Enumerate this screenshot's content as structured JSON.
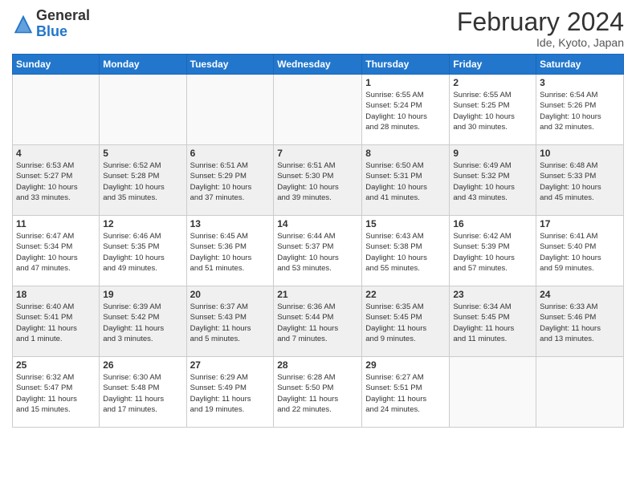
{
  "header": {
    "logo_general": "General",
    "logo_blue": "Blue",
    "month_year": "February 2024",
    "location": "Ide, Kyoto, Japan"
  },
  "days_of_week": [
    "Sunday",
    "Monday",
    "Tuesday",
    "Wednesday",
    "Thursday",
    "Friday",
    "Saturday"
  ],
  "weeks": [
    {
      "shaded": false,
      "days": [
        {
          "num": "",
          "info": ""
        },
        {
          "num": "",
          "info": ""
        },
        {
          "num": "",
          "info": ""
        },
        {
          "num": "",
          "info": ""
        },
        {
          "num": "1",
          "info": "Sunrise: 6:55 AM\nSunset: 5:24 PM\nDaylight: 10 hours\nand 28 minutes."
        },
        {
          "num": "2",
          "info": "Sunrise: 6:55 AM\nSunset: 5:25 PM\nDaylight: 10 hours\nand 30 minutes."
        },
        {
          "num": "3",
          "info": "Sunrise: 6:54 AM\nSunset: 5:26 PM\nDaylight: 10 hours\nand 32 minutes."
        }
      ]
    },
    {
      "shaded": true,
      "days": [
        {
          "num": "4",
          "info": "Sunrise: 6:53 AM\nSunset: 5:27 PM\nDaylight: 10 hours\nand 33 minutes."
        },
        {
          "num": "5",
          "info": "Sunrise: 6:52 AM\nSunset: 5:28 PM\nDaylight: 10 hours\nand 35 minutes."
        },
        {
          "num": "6",
          "info": "Sunrise: 6:51 AM\nSunset: 5:29 PM\nDaylight: 10 hours\nand 37 minutes."
        },
        {
          "num": "7",
          "info": "Sunrise: 6:51 AM\nSunset: 5:30 PM\nDaylight: 10 hours\nand 39 minutes."
        },
        {
          "num": "8",
          "info": "Sunrise: 6:50 AM\nSunset: 5:31 PM\nDaylight: 10 hours\nand 41 minutes."
        },
        {
          "num": "9",
          "info": "Sunrise: 6:49 AM\nSunset: 5:32 PM\nDaylight: 10 hours\nand 43 minutes."
        },
        {
          "num": "10",
          "info": "Sunrise: 6:48 AM\nSunset: 5:33 PM\nDaylight: 10 hours\nand 45 minutes."
        }
      ]
    },
    {
      "shaded": false,
      "days": [
        {
          "num": "11",
          "info": "Sunrise: 6:47 AM\nSunset: 5:34 PM\nDaylight: 10 hours\nand 47 minutes."
        },
        {
          "num": "12",
          "info": "Sunrise: 6:46 AM\nSunset: 5:35 PM\nDaylight: 10 hours\nand 49 minutes."
        },
        {
          "num": "13",
          "info": "Sunrise: 6:45 AM\nSunset: 5:36 PM\nDaylight: 10 hours\nand 51 minutes."
        },
        {
          "num": "14",
          "info": "Sunrise: 6:44 AM\nSunset: 5:37 PM\nDaylight: 10 hours\nand 53 minutes."
        },
        {
          "num": "15",
          "info": "Sunrise: 6:43 AM\nSunset: 5:38 PM\nDaylight: 10 hours\nand 55 minutes."
        },
        {
          "num": "16",
          "info": "Sunrise: 6:42 AM\nSunset: 5:39 PM\nDaylight: 10 hours\nand 57 minutes."
        },
        {
          "num": "17",
          "info": "Sunrise: 6:41 AM\nSunset: 5:40 PM\nDaylight: 10 hours\nand 59 minutes."
        }
      ]
    },
    {
      "shaded": true,
      "days": [
        {
          "num": "18",
          "info": "Sunrise: 6:40 AM\nSunset: 5:41 PM\nDaylight: 11 hours\nand 1 minute."
        },
        {
          "num": "19",
          "info": "Sunrise: 6:39 AM\nSunset: 5:42 PM\nDaylight: 11 hours\nand 3 minutes."
        },
        {
          "num": "20",
          "info": "Sunrise: 6:37 AM\nSunset: 5:43 PM\nDaylight: 11 hours\nand 5 minutes."
        },
        {
          "num": "21",
          "info": "Sunrise: 6:36 AM\nSunset: 5:44 PM\nDaylight: 11 hours\nand 7 minutes."
        },
        {
          "num": "22",
          "info": "Sunrise: 6:35 AM\nSunset: 5:45 PM\nDaylight: 11 hours\nand 9 minutes."
        },
        {
          "num": "23",
          "info": "Sunrise: 6:34 AM\nSunset: 5:45 PM\nDaylight: 11 hours\nand 11 minutes."
        },
        {
          "num": "24",
          "info": "Sunrise: 6:33 AM\nSunset: 5:46 PM\nDaylight: 11 hours\nand 13 minutes."
        }
      ]
    },
    {
      "shaded": false,
      "days": [
        {
          "num": "25",
          "info": "Sunrise: 6:32 AM\nSunset: 5:47 PM\nDaylight: 11 hours\nand 15 minutes."
        },
        {
          "num": "26",
          "info": "Sunrise: 6:30 AM\nSunset: 5:48 PM\nDaylight: 11 hours\nand 17 minutes."
        },
        {
          "num": "27",
          "info": "Sunrise: 6:29 AM\nSunset: 5:49 PM\nDaylight: 11 hours\nand 19 minutes."
        },
        {
          "num": "28",
          "info": "Sunrise: 6:28 AM\nSunset: 5:50 PM\nDaylight: 11 hours\nand 22 minutes."
        },
        {
          "num": "29",
          "info": "Sunrise: 6:27 AM\nSunset: 5:51 PM\nDaylight: 11 hours\nand 24 minutes."
        },
        {
          "num": "",
          "info": ""
        },
        {
          "num": "",
          "info": ""
        }
      ]
    }
  ]
}
